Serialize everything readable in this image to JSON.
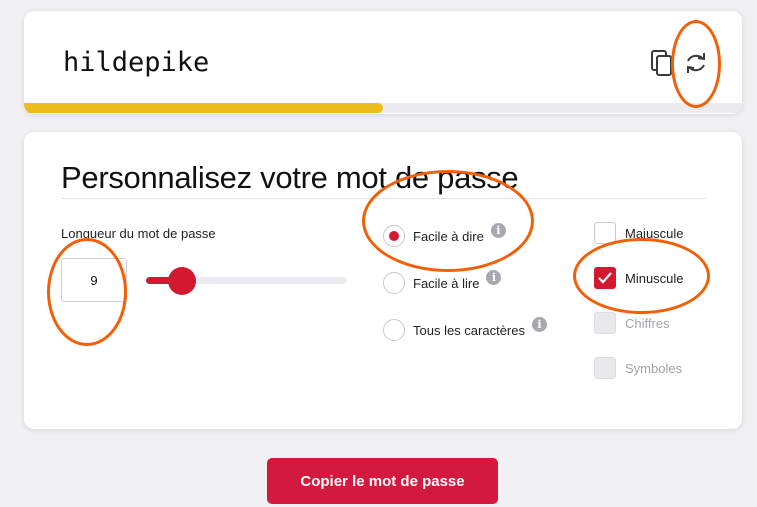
{
  "generated": {
    "password": "hildepike",
    "strength_fraction": 0.5
  },
  "config": {
    "title": "Personnalisez votre mot de passe",
    "length_label": "Longueur du mot de passe",
    "length_value": "9",
    "slider_fraction": 0.18,
    "modes": [
      {
        "label": "Facile à dire",
        "selected": true,
        "info_icon": "info-icon"
      },
      {
        "label": "Facile à lire",
        "selected": false,
        "info_icon": "info-icon"
      },
      {
        "label": "Tous les caractères",
        "selected": false,
        "info_icon": "info-icon"
      }
    ],
    "options": [
      {
        "label": "Majuscule",
        "checked": false,
        "disabled": false
      },
      {
        "label": "Minuscule",
        "checked": true,
        "disabled": false
      },
      {
        "label": "Chiffres",
        "checked": false,
        "disabled": true
      },
      {
        "label": "Symboles",
        "checked": false,
        "disabled": true
      }
    ]
  },
  "actions": {
    "copy_label": "Copier le mot de passe",
    "copy_icon": "copy-icon",
    "refresh_icon": "refresh-icon"
  },
  "colors": {
    "accent": "#d3192f",
    "strength": "#ebbd1a",
    "annotation": "#f35f06"
  }
}
